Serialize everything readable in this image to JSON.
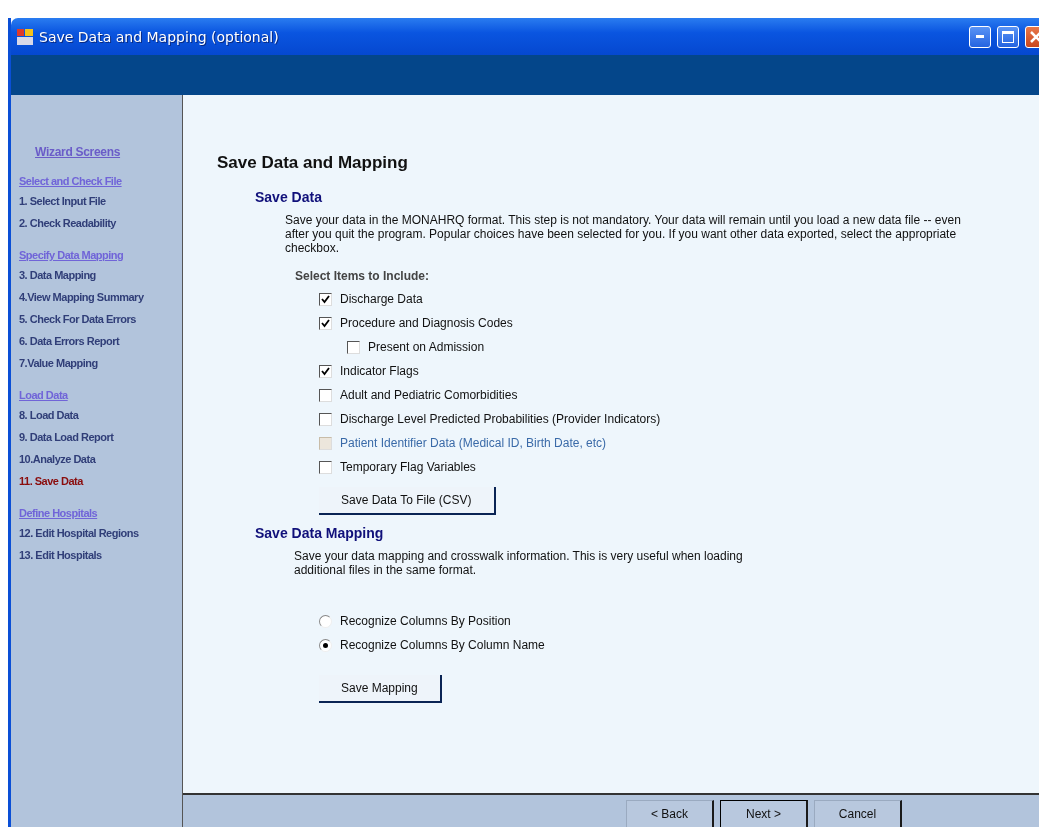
{
  "window": {
    "title": "Save Data and Mapping (optional)"
  },
  "sidebar": {
    "title": "Wizard Screens",
    "sections": [
      {
        "header": "Select and Check File",
        "items": [
          {
            "label": "1. Select Input File",
            "selected": false
          },
          {
            "label": "2. Check Readability",
            "selected": false
          }
        ]
      },
      {
        "header": "Specify Data Mapping",
        "items": [
          {
            "label": "3. Data Mapping",
            "selected": false
          },
          {
            "label": "4.View Mapping Summary",
            "selected": false
          },
          {
            "label": "5. Check For Data Errors",
            "selected": false
          },
          {
            "label": "6. Data Errors Report",
            "selected": false
          },
          {
            "label": "7.Value Mapping",
            "selected": false
          }
        ]
      },
      {
        "header": "Load Data",
        "items": [
          {
            "label": "8. Load Data",
            "selected": false
          },
          {
            "label": "9. Data Load Report",
            "selected": false
          },
          {
            "label": "10.Analyze Data",
            "selected": false
          },
          {
            "label": "11. Save Data",
            "selected": true
          }
        ]
      },
      {
        "header": "Define Hospitals",
        "items": [
          {
            "label": "12. Edit Hospital Regions",
            "selected": false
          },
          {
            "label": "13. Edit Hospitals",
            "selected": false
          }
        ]
      }
    ]
  },
  "page_title": "Save Data and Mapping",
  "save_data": {
    "heading": "Save Data",
    "description": "Save your data in the MONAHRQ format. This step is not mandatory. Your data will remain until you load a new data file -- even after you quit the program. Popular choices have been selected for you. If you want other data exported, select the appropriate checkbox.",
    "select_label": "Select Items to Include:",
    "options": [
      {
        "label": "Discharge Data",
        "checked": true,
        "disabled": false
      },
      {
        "label": "Procedure and Diagnosis Codes",
        "checked": true,
        "disabled": false,
        "children": [
          {
            "label": "Present on Admission",
            "checked": false,
            "disabled": false
          }
        ]
      },
      {
        "label": "Indicator Flags",
        "checked": true,
        "disabled": false
      },
      {
        "label": "Adult and Pediatric Comorbidities",
        "checked": false,
        "disabled": false
      },
      {
        "label": "Discharge Level Predicted Probabilities (Provider Indicators)",
        "checked": false,
        "disabled": false
      },
      {
        "label": "Patient Identifier Data  (Medical ID, Birth Date, etc)",
        "checked": false,
        "disabled": true
      },
      {
        "label": "Temporary Flag Variables",
        "checked": false,
        "disabled": false
      }
    ],
    "button": "Save Data To File (CSV)"
  },
  "save_mapping": {
    "heading": "Save Data Mapping",
    "description": "Save your data mapping and crosswalk information.  This is very useful when loading\nadditional files in the same format.",
    "options": [
      {
        "label": "Recognize Columns By Position",
        "selected": false
      },
      {
        "label": "Recognize Columns By Column Name",
        "selected": true
      }
    ],
    "button": "Save Mapping"
  },
  "footer_buttons": [
    {
      "label": "< Back",
      "default": false
    },
    {
      "label": "Next >",
      "default": true
    },
    {
      "label": "Cancel",
      "default": false
    }
  ]
}
